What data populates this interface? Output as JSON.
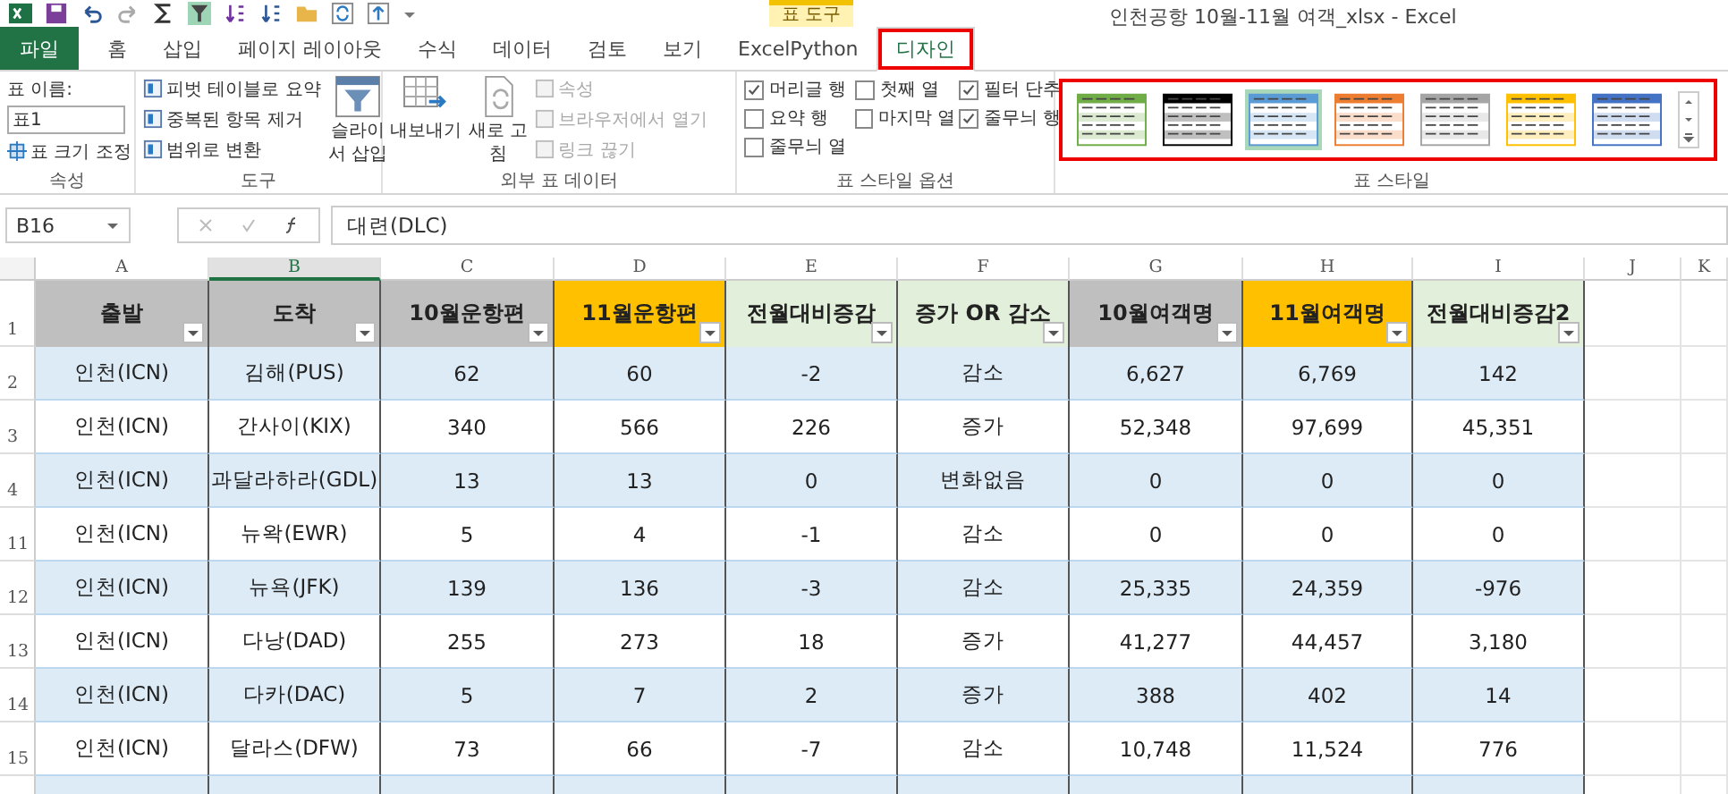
{
  "window": {
    "title": "인천공항 10월-11월 여객_xlsx - Excel",
    "context_group": "표 도구"
  },
  "tabs": [
    {
      "label": "파일",
      "kind": "file",
      "selected": false,
      "highlighted": false
    },
    {
      "label": "홈",
      "kind": "tab",
      "selected": false,
      "highlighted": false
    },
    {
      "label": "삽입",
      "kind": "tab",
      "selected": false,
      "highlighted": false
    },
    {
      "label": "페이지 레이아웃",
      "kind": "tab",
      "selected": false,
      "highlighted": false
    },
    {
      "label": "수식",
      "kind": "tab",
      "selected": false,
      "highlighted": false
    },
    {
      "label": "데이터",
      "kind": "tab",
      "selected": false,
      "highlighted": false
    },
    {
      "label": "검토",
      "kind": "tab",
      "selected": false,
      "highlighted": false
    },
    {
      "label": "보기",
      "kind": "tab",
      "selected": false,
      "highlighted": false
    },
    {
      "label": "ExcelPython",
      "kind": "tab",
      "selected": false,
      "highlighted": false
    },
    {
      "label": "디자인",
      "kind": "tab",
      "selected": true,
      "highlighted": true
    }
  ],
  "ribbon": {
    "properties": {
      "name_label": "표 이름:",
      "name_value": "표1",
      "resize": "표 크기 조정",
      "title": "속성"
    },
    "tools": {
      "items": [
        "피벗 테이블로 요약",
        "중복된 항목 제거",
        "범위로 변환"
      ],
      "slicer": [
        "슬라이",
        "서 삽입"
      ],
      "title": "도구"
    },
    "external": {
      "export": "내보내기",
      "refresh": [
        "새로 고",
        "침"
      ],
      "items": [
        {
          "label": "속성",
          "disabled": true
        },
        {
          "label": "브라우저에서 열기",
          "disabled": true
        },
        {
          "label": "링크 끊기",
          "disabled": true
        }
      ],
      "title": "외부 표 데이터"
    },
    "style_options": {
      "options": [
        {
          "label": "머리글 행",
          "checked": true
        },
        {
          "label": "첫째 열",
          "checked": false
        },
        {
          "label": "필터 단추",
          "checked": true
        },
        {
          "label": "요약 행",
          "checked": false
        },
        {
          "label": "마지막 열",
          "checked": false
        },
        {
          "label": "줄무늬 행",
          "checked": true
        },
        {
          "label": "줄무늬 열",
          "checked": false
        }
      ],
      "title": "표 스타일 옵션"
    },
    "styles": {
      "highlighted": true,
      "title": "표 스타일",
      "swatches": [
        {
          "color": "#70ad47",
          "selected": false
        },
        {
          "color": "#000000",
          "selected": false
        },
        {
          "color": "#5b9bd5",
          "selected": true
        },
        {
          "color": "#ed7d31",
          "selected": false
        },
        {
          "color": "#a5a5a5",
          "selected": false
        },
        {
          "color": "#ffc000",
          "selected": false
        },
        {
          "color": "#4472c4",
          "selected": false
        }
      ]
    }
  },
  "formula_bar": {
    "name_box": "B16",
    "value": "대련(DLC)"
  },
  "sheet": {
    "columns": [
      {
        "letter": "A",
        "selected": false
      },
      {
        "letter": "B",
        "selected": true
      },
      {
        "letter": "C",
        "selected": false
      },
      {
        "letter": "D",
        "selected": false
      },
      {
        "letter": "E",
        "selected": false
      },
      {
        "letter": "F",
        "selected": false
      },
      {
        "letter": "G",
        "selected": false
      },
      {
        "letter": "H",
        "selected": false
      },
      {
        "letter": "I",
        "selected": false
      },
      {
        "letter": "J",
        "selected": false
      },
      {
        "letter": "K",
        "selected": false
      }
    ],
    "header_row": "1",
    "headers": [
      {
        "label": "출발",
        "color": "#bfbfbf"
      },
      {
        "label": "도착",
        "color": "#bfbfbf"
      },
      {
        "label": "10월운항편",
        "color": "#bfbfbf"
      },
      {
        "label": "11월운항편",
        "color": "#ffc000"
      },
      {
        "label": "전월대비증감",
        "color": "#e2efda"
      },
      {
        "label": "증가 OR 감소",
        "color": "#e2efda"
      },
      {
        "label": "10월여객명",
        "color": "#bfbfbf"
      },
      {
        "label": "11월여객명",
        "color": "#ffc000"
      },
      {
        "label": "전월대비증감2",
        "color": "#e2efda"
      }
    ],
    "rows": [
      {
        "number": "2",
        "cells": [
          "인천(ICN)",
          "김해(PUS)",
          "62",
          "60",
          "-2",
          "감소",
          "6,627",
          "6,769",
          "142"
        ]
      },
      {
        "number": "3",
        "cells": [
          "인천(ICN)",
          "간사이(KIX)",
          "340",
          "566",
          "226",
          "증가",
          "52,348",
          "97,699",
          "45,351"
        ]
      },
      {
        "number": "4",
        "cells": [
          "인천(ICN)",
          "과달라하라(GDL)",
          "13",
          "13",
          "0",
          "변화없음",
          "0",
          "0",
          "0"
        ]
      },
      {
        "number": "11",
        "cells": [
          "인천(ICN)",
          "뉴왁(EWR)",
          "5",
          "4",
          "-1",
          "감소",
          "0",
          "0",
          "0"
        ]
      },
      {
        "number": "12",
        "cells": [
          "인천(ICN)",
          "뉴욕(JFK)",
          "139",
          "136",
          "-3",
          "감소",
          "25,335",
          "24,359",
          "-976"
        ]
      },
      {
        "number": "13",
        "cells": [
          "인천(ICN)",
          "다낭(DAD)",
          "255",
          "273",
          "18",
          "증가",
          "41,277",
          "44,457",
          "3,180"
        ]
      },
      {
        "number": "14",
        "cells": [
          "인천(ICN)",
          "다카(DAC)",
          "5",
          "7",
          "2",
          "증가",
          "388",
          "402",
          "14"
        ]
      },
      {
        "number": "15",
        "cells": [
          "인천(ICN)",
          "달라스(DFW)",
          "73",
          "66",
          "-7",
          "감소",
          "10,748",
          "11,524",
          "776"
        ]
      }
    ]
  }
}
